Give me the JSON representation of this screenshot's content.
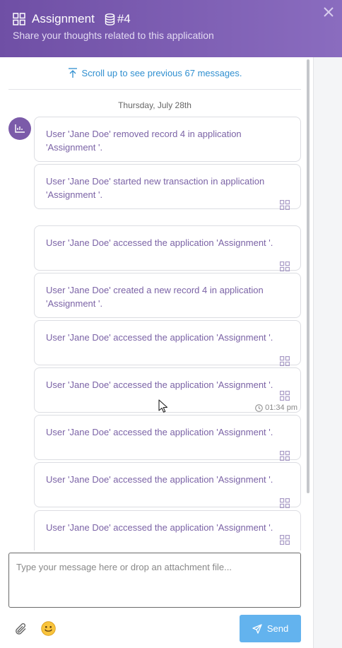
{
  "header": {
    "title": "Assignment",
    "record": "#4",
    "subtitle": "Share your thoughts related to this application",
    "icons": {
      "app": "grid-icon",
      "record": "database-icon",
      "close": "close-icon"
    }
  },
  "feed": {
    "scroll_up_text": "Scroll up to see previous 67 messages.",
    "date_label": "Thursday, July 28th",
    "messages": [
      {
        "text": "User 'Jane Doe' removed record 4 in application 'Assignment '."
      },
      {
        "text": "User 'Jane Doe' started new transaction in application 'Assignment '."
      },
      {
        "text": "User 'Jane Doe' accessed the application 'Assignment '."
      },
      {
        "text": "User 'Jane Doe' created a new record 4 in application 'Assignment '."
      },
      {
        "text": "User 'Jane Doe' accessed the application 'Assignment '."
      },
      {
        "text": "User 'Jane Doe' accessed the application 'Assignment '.",
        "time": "01:34 pm"
      },
      {
        "text": "User 'Jane Doe' accessed the application 'Assignment '."
      },
      {
        "text": "User 'Jane Doe' accessed the application 'Assignment '."
      },
      {
        "text": "User 'Jane Doe' accessed the application 'Assignment '."
      }
    ]
  },
  "composer": {
    "placeholder": "Type your message here or drop an attachment file...",
    "value": ""
  },
  "footer": {
    "send_label": "Send"
  },
  "colors": {
    "header_start": "#6f4fa5",
    "header_end": "#8a6cbf",
    "message_text": "#7b63a6",
    "link": "#2f8fd0",
    "send_button": "#63b3ee",
    "avatar": "#7b5ba9"
  }
}
